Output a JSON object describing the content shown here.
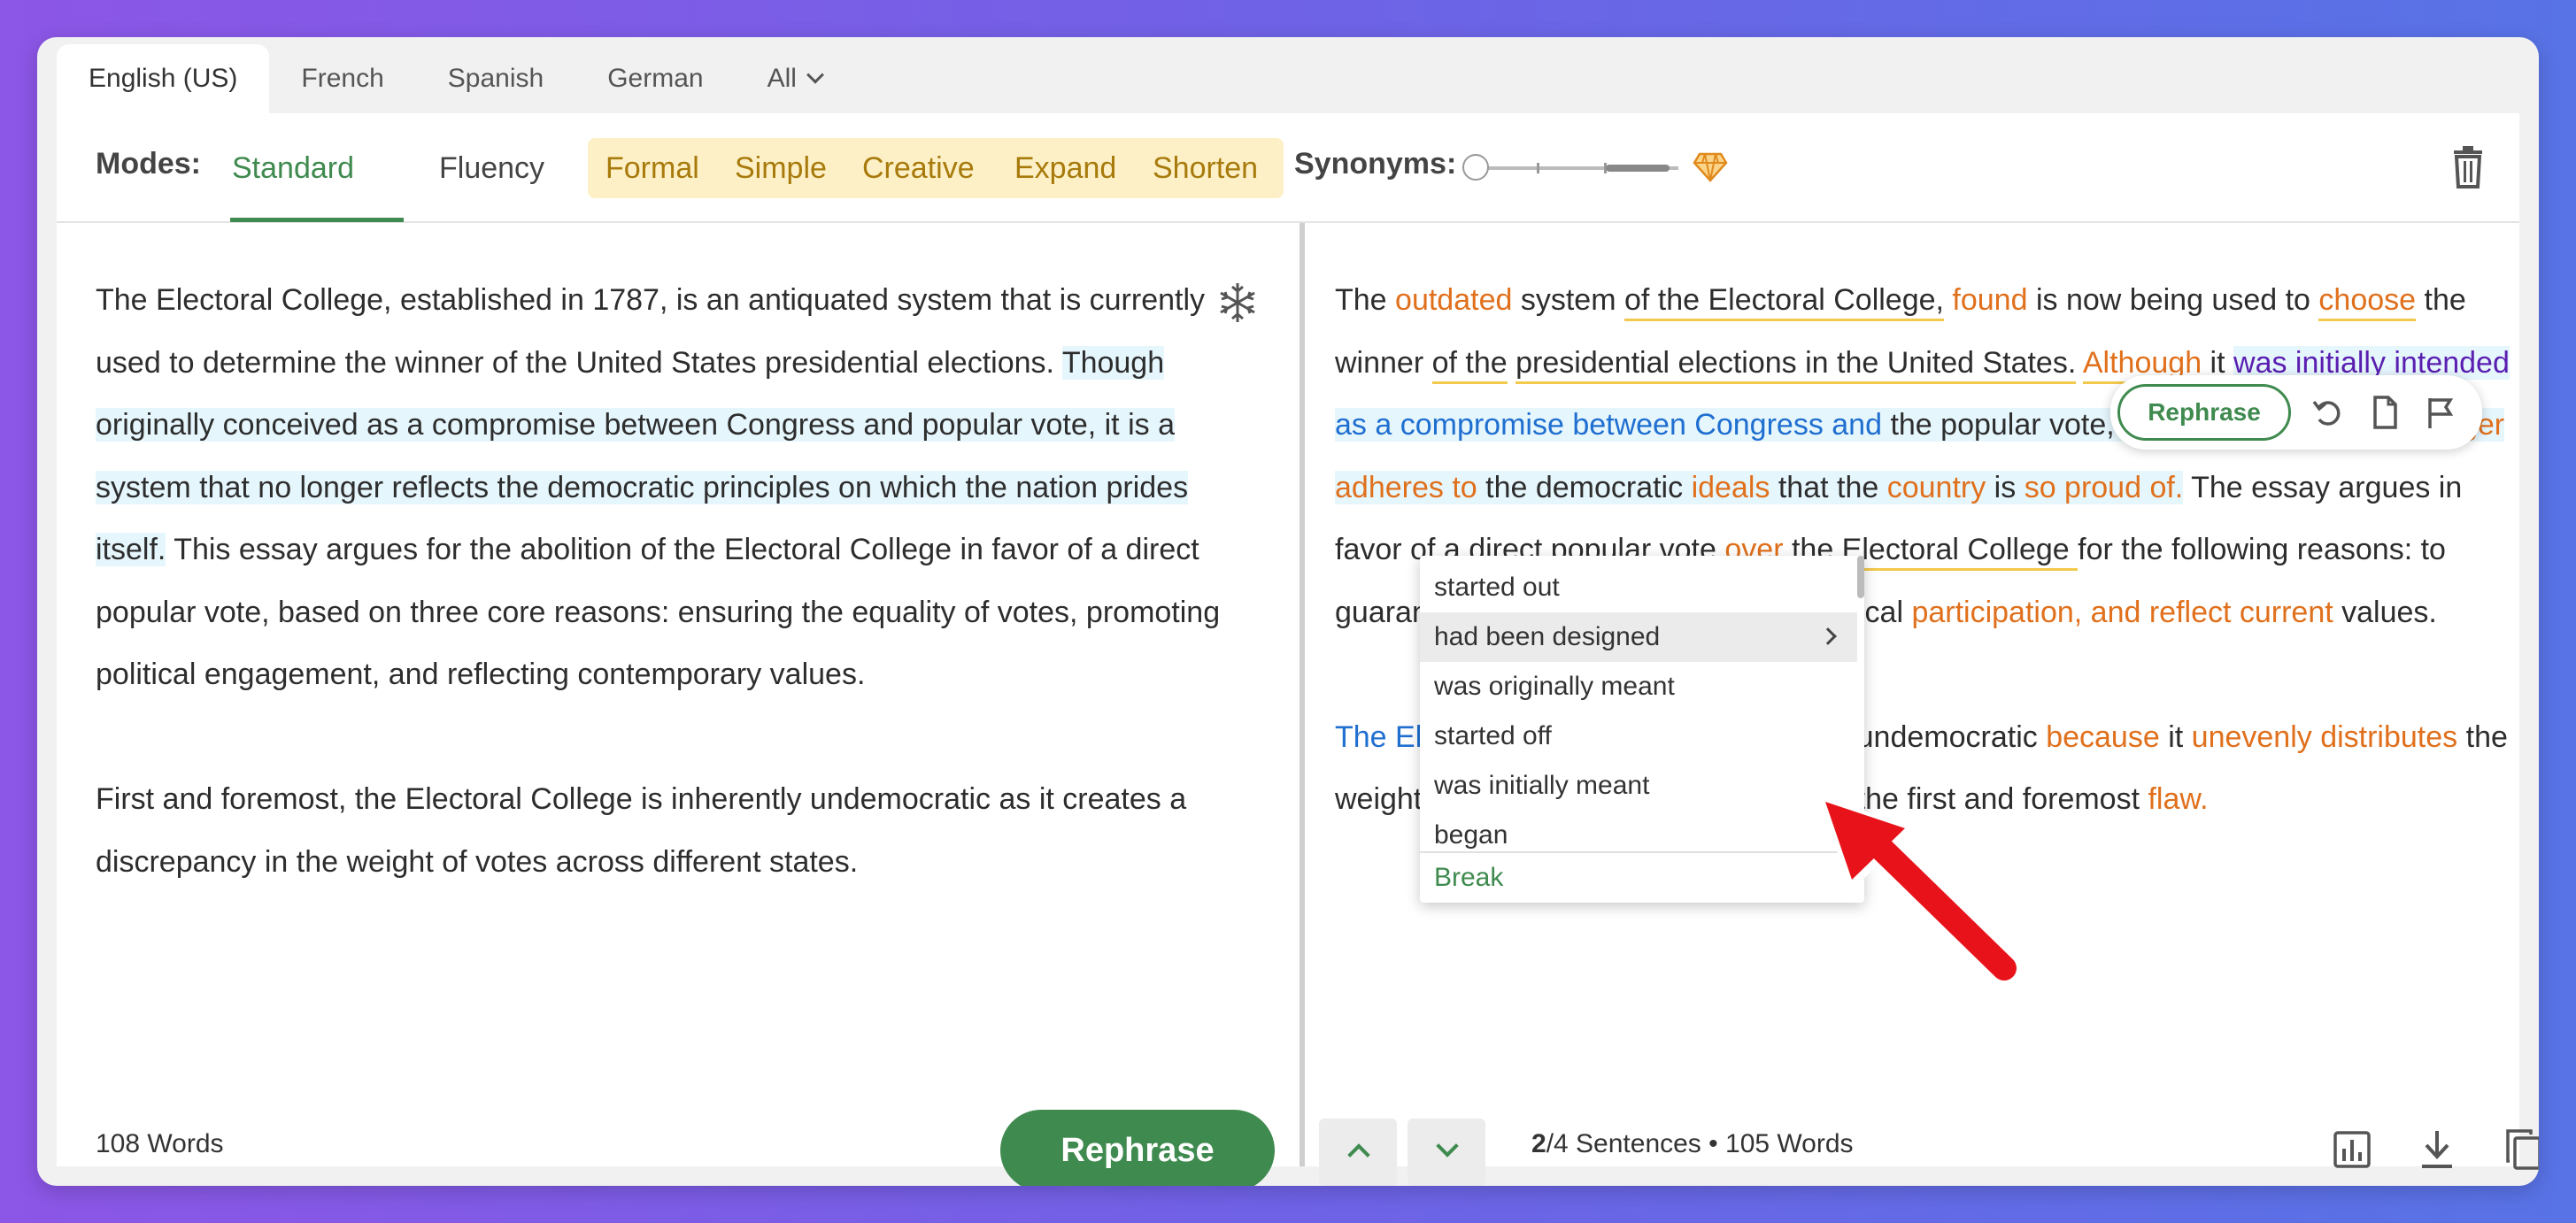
{
  "languages": [
    "English (US)",
    "French",
    "Spanish",
    "German",
    "All"
  ],
  "modes": {
    "label": "Modes:",
    "standard": "Standard",
    "fluency": "Fluency",
    "premium": [
      "Formal",
      "Simple",
      "Creative",
      "Expand",
      "Shorten"
    ]
  },
  "synonyms": {
    "label": "Synonyms:"
  },
  "input": {
    "p1": [
      "The Electoral College, established in 1787, is an antiquated system that is currently used to determine the winner of the United States presidential elections. ",
      "Though originally conceived as a compromise between Congress and popular vote, it is a system that no longer reflects the democratic principles on which the nation prides itself.",
      " This essay argues for the abolition of the Electoral College in favor of a direct popular vote, based on three core reasons: ensuring the equality of votes, promoting political engagement, and reflecting contemporary values."
    ],
    "p2": "First and foremost, the Electoral College is inherently undemocratic as it creates a discrepancy in the weight of votes across different states.",
    "word_count": "108 Words"
  },
  "rephrase_button": "Rephrase",
  "output": {
    "p1": [
      {
        "t": "The ",
        "c": ""
      },
      {
        "t": "outdated",
        "c": "o"
      },
      {
        "t": " system ",
        "c": ""
      },
      {
        "t": "of the Electoral College,",
        "c": "yu"
      },
      {
        "t": " ",
        "c": ""
      },
      {
        "t": "found",
        "c": "o"
      },
      {
        "t": " ",
        "c": ""
      },
      {
        "t": "is now being used to",
        "c": ""
      },
      {
        "t": " ",
        "c": ""
      },
      {
        "t": "choose",
        "c": "o yu"
      },
      {
        "t": " the winner ",
        "c": ""
      },
      {
        "t": "of the",
        "c": "yu"
      },
      {
        "t": " ",
        "c": ""
      },
      {
        "t": "presidential elections in the United States.",
        "c": "yu"
      },
      {
        "t": " ",
        "c": ""
      },
      {
        "t": "Although",
        "c": "o yu"
      },
      {
        "t": " it ",
        "c": ""
      },
      {
        "t": "was initially intended",
        "c": "pu hlb"
      },
      {
        "t": " ",
        "c": "hlb"
      },
      {
        "t": "as a compromise between Congress and",
        "c": "b hlb"
      },
      {
        "t": " the popular vote,",
        "c": "hlb"
      },
      {
        "t": " the ",
        "c": "hlb"
      },
      {
        "t": "current system no longer adheres to",
        "c": "o hlb"
      },
      {
        "t": " the democratic ",
        "c": "hlb"
      },
      {
        "t": "ideals",
        "c": "o hlb"
      },
      {
        "t": " that the ",
        "c": "hlb"
      },
      {
        "t": "country",
        "c": "o hlb"
      },
      {
        "t": " is ",
        "c": "hlb"
      },
      {
        "t": "so proud of.",
        "c": "o hlb"
      },
      {
        "t": " The ",
        "c": ""
      },
      {
        "t": "essay argues in favor of a",
        "c": ""
      },
      {
        "t": " direct popular vote ",
        "c": "yu"
      },
      {
        "t": "over",
        "c": "o yu"
      },
      {
        "t": " the Electoral College ",
        "c": "yu"
      },
      {
        "t": "for the following reasons: to guarantee",
        "c": ""
      },
      {
        "t": " electoral equality, ",
        "c": ""
      },
      {
        "t": "foster",
        "c": "o"
      },
      {
        "t": " political ",
        "c": ""
      },
      {
        "t": "participation, and reflect current",
        "c": "o"
      },
      {
        "t": " values.",
        "c": ""
      }
    ],
    "p2": [
      {
        "t": "The Electoral College is ",
        "c": "b"
      },
      {
        "t": "fundamentally",
        "c": "o"
      },
      {
        "t": " undemocratic ",
        "c": ""
      },
      {
        "t": "because",
        "c": "o"
      },
      {
        "t": " it ",
        "c": ""
      },
      {
        "t": "unevenly distributes",
        "c": "o"
      },
      {
        "t": " the weight of votes ",
        "c": ""
      },
      {
        "t": "among",
        "c": "o"
      },
      {
        "t": " states, ",
        "c": ""
      },
      {
        "t": "which",
        "c": "o"
      },
      {
        "t": " is the first and foremost ",
        "c": ""
      },
      {
        "t": "flaw.",
        "c": "o"
      }
    ],
    "sentence_current": "2",
    "sentence_total": "/4 Sentences",
    "bullet": "•",
    "word_count": "105 Words"
  },
  "popover": {
    "rephrase": "Rephrase"
  },
  "synonym_dropdown": {
    "items": [
      "started out",
      "had been designed",
      "was originally meant",
      "started off",
      "was initially meant",
      "began"
    ],
    "selected_index": 1,
    "break_label": "Break"
  },
  "icons": {
    "tab_chevron": "chevron-down-icon",
    "gem": "diamond-gem-icon",
    "trash": "trash-icon",
    "freeze": "freeze-snowflake-icon",
    "undo": "undo-icon",
    "doc": "document-icon",
    "flag": "flag-icon",
    "stats": "bar-chart-icon",
    "download": "download-icon",
    "copy": "copy-icon"
  },
  "colors": {
    "brand_green": "#3f8a4f",
    "changed_word": "#e0701c",
    "structural_change": "#1f6fd0",
    "selected_phrase": "#5a1fb0",
    "premium_bg": "#fdf0c6"
  }
}
